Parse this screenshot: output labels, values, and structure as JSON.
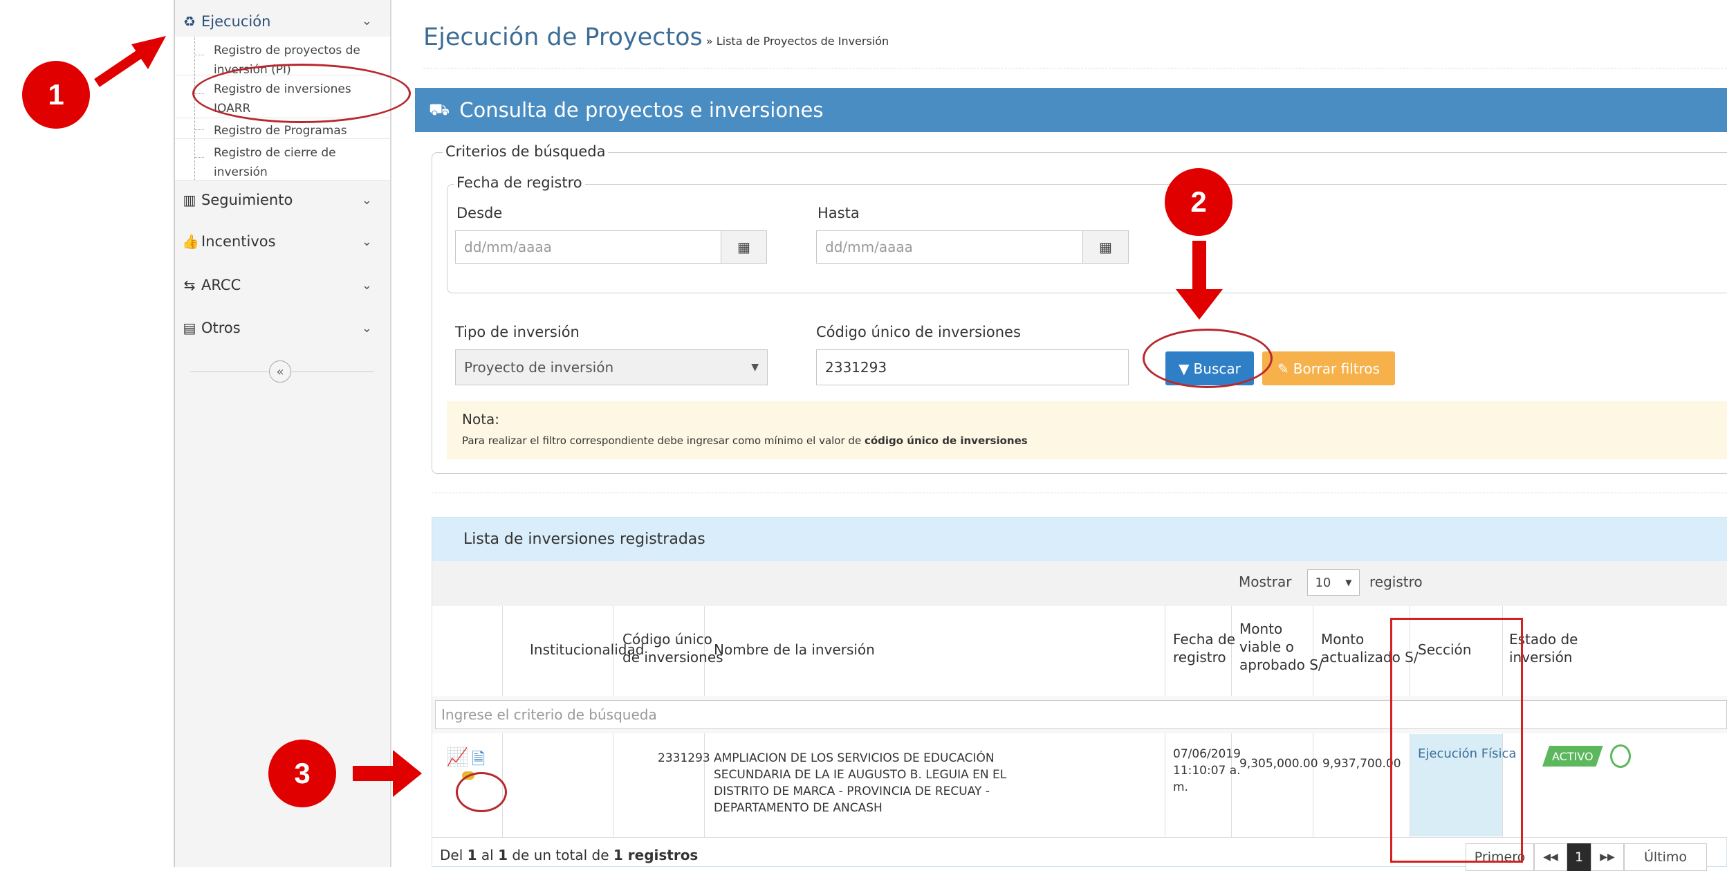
{
  "markers": [
    "1",
    "2",
    "3"
  ],
  "sidebar": {
    "ejecucion": "Ejecución",
    "sub_items": [
      {
        "line1": "Registro de proyectos de",
        "line2": "inversión (PI)"
      },
      {
        "line1": "Registro de inversiones",
        "line2": "IOARR"
      },
      {
        "line1": "Registro de Programas",
        "line2": ""
      },
      {
        "line1": "Registro de cierre de",
        "line2": "inversión"
      }
    ],
    "seguimiento": "Seguimiento",
    "incentivos": "Incentivos",
    "arcc": "ARCC",
    "otros": "Otros",
    "collapse_glyph": "«"
  },
  "page": {
    "title": "Ejecución de Proyectos",
    "breadcrumb": "» Lista de Proyectos de Inversión"
  },
  "panel": {
    "title": "Consulta de proyectos e inversiones"
  },
  "criteria": {
    "legend": "Criterios de búsqueda",
    "fecha_legend": "Fecha de registro",
    "desde_label": "Desde",
    "hasta_label": "Hasta",
    "date_placeholder": "dd/mm/aaaa",
    "tipo_label": "Tipo de inversión",
    "tipo_value": "Proyecto de inversión",
    "codigo_label": "Código único de inversiones",
    "codigo_value": "2331293",
    "buscar_label": "Buscar",
    "borrar_label": "Borrar filtros",
    "note_title": "Nota:",
    "note_text_before": "Para realizar el filtro correspondiente debe ingresar como mínimo el valor de ",
    "note_text_bold": "código único de inversiones"
  },
  "list": {
    "title": "Lista de inversiones registradas",
    "mostrar_label": "Mostrar",
    "mostrar_value": "10",
    "registros_label": "registro",
    "headers": {
      "institucionalidad": "Institucionalidad",
      "codigo_1": "Código único",
      "codigo_2": "de inversiones",
      "nombre": "Nombre de la inversión",
      "fecha_1": "Fecha de",
      "fecha_2": "registro",
      "monto_viable_1": "Monto",
      "monto_viable_2": "viable o",
      "monto_viable_3": "aprobado S/",
      "monto_act_1": "Monto",
      "monto_act_2": "actualizado S/",
      "seccion": "Sección",
      "estado_1": "Estado de",
      "estado_2": "inversión"
    },
    "filter_placeholder": "Ingrese el criterio de búsqueda",
    "row": {
      "codigo": "2331293",
      "nombre_1": "AMPLIACION DE LOS SERVICIOS DE EDUCACIÓN",
      "nombre_2": "SECUNDARIA DE LA IE AUGUSTO B. LEGUIA EN EL",
      "nombre_3": "DISTRITO DE MARCA - PROVINCIA DE RECUAY -",
      "nombre_4": "DEPARTAMENTO DE ANCASH",
      "fecha_1": "07/06/2019",
      "fecha_2": "11:10:07 a.",
      "fecha_3": "m.",
      "monto_viable": "9,305,000.00",
      "monto_actualizado": "9,937,700.00",
      "seccion": "Ejecución Física",
      "estado": "ACTIVO"
    },
    "summary": {
      "prefix": "Del ",
      "from": "1",
      "mid1": " al ",
      "to": "1",
      "mid2": " de un total de ",
      "total": "1",
      "suffix": " registros"
    },
    "pagination": {
      "primero": "Primero",
      "prev": "◀◀",
      "page": "1",
      "next": "▶▶",
      "ultimo": "Último"
    }
  },
  "colors": {
    "marker_red": "#e00000",
    "panel_blue": "#4a8dc2",
    "title_blue": "#3c6d97",
    "buscar_blue": "#2f7fc7",
    "borrar_orange": "#f7b14a",
    "seccion_bg": "#d9edf7",
    "activo_green": "#5cb85c"
  }
}
